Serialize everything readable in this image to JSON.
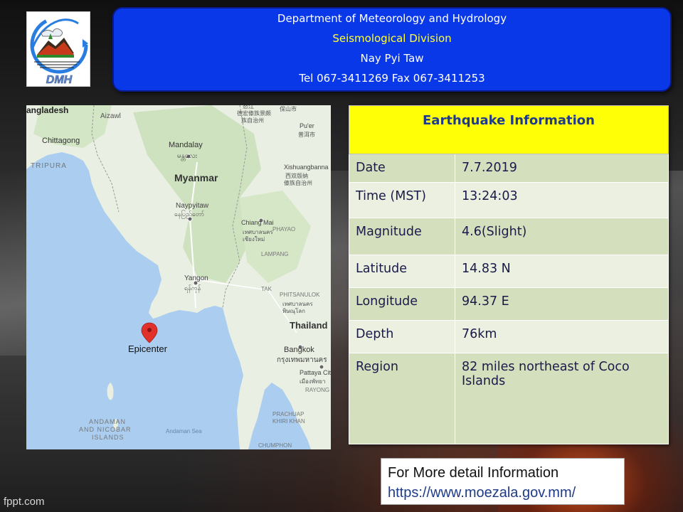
{
  "logo": {
    "text": "DMH",
    "icon": "dmh-logo-icon"
  },
  "header": {
    "line1": "Department of Meteorology and Hydrology",
    "line2": "Seismological Division",
    "line3": "Nay Pyi Taw",
    "line4": "Tel 067-3411269 Fax 067-3411253"
  },
  "map": {
    "epicenter_label": "Epicenter",
    "labels": {
      "bangladesh": "angladesh",
      "chittagong": "Chittagong",
      "aizawl": "Aizawl",
      "tripura": "TRIPURA",
      "mandalay": "Mandalay",
      "mandalay_local": "မန္တလေး",
      "myanmar": "Myanmar",
      "naypyitaw": "Naypyitaw",
      "naypyitaw_local": "နေပြည်တော်",
      "yangon": "Yangon",
      "yangon_local": "ရန်ကုန်",
      "thailand": "Thailand",
      "bangkok": "Bangkok",
      "bangkok_local": "กรุงเทพมหานคร",
      "pattaya": "Pattaya City",
      "pattaya_local": "เมืองพัทยา",
      "rayong": "RAYONG",
      "prachuap": "PRACHUAP",
      "khiri_khan": "KHIRI KHAN",
      "andaman_nicobar_1": "ANDAMAN",
      "andaman_nicobar_2": "AND NICOBAR",
      "andaman_nicobar_3": "ISLANDS",
      "andaman_sea": "Andaman Sea",
      "chiang_mai": "Chiang Mai",
      "chiang_mai_local_1": "เทศบาลนคร",
      "chiang_mai_local_2": "เชียงใหม่",
      "phayao": "PHAYAO",
      "lampang": "LAMPANG",
      "tak": "TAK",
      "phitsanulok": "PHITSANULOK",
      "phitsanulok_local_1": "เทศบาลนคร",
      "phitsanulok_local_2": "พิษณุโลก",
      "xishuangbanna": "Xishuangbanna",
      "xishuangbanna_local_1": "西双版纳",
      "xishuangbanna_local_2": "傣族自治州",
      "puer": "Pu'er",
      "puer_local": "普洱市",
      "dehong_1": "德宏傣族景颇",
      "dehong_2": "族自治州",
      "nujiang": "怒江",
      "baoshan": "保山市",
      "chumphon": "CHUMPHON"
    }
  },
  "info": {
    "title": "Earthquake Information",
    "rows": [
      {
        "key": "Date",
        "value": "7.7.2019"
      },
      {
        "key": "Time (MST)",
        "value": "13:24:03"
      },
      {
        "key": "Magnitude",
        "value": "4.6(Slight)"
      },
      {
        "key": "Latitude",
        "value": "14.83 N"
      },
      {
        "key": "Longitude",
        "value": "94.37 E"
      },
      {
        "key": "Depth",
        "value": "76km"
      },
      {
        "key": "Region",
        "value": "82 miles northeast of Coco Islands"
      }
    ]
  },
  "more": {
    "label": "For More detail Information",
    "url": "https://www.moezala.gov.mm/"
  },
  "footer": {
    "watermark": "fppt.com"
  },
  "colors": {
    "header_bg": "#0838e8",
    "header_highlight": "#ffff3c",
    "table_title_bg": "#ffff05",
    "row_dark": "#d4e0bd",
    "row_light": "#ebf0e0",
    "marker": "#e0322a"
  }
}
